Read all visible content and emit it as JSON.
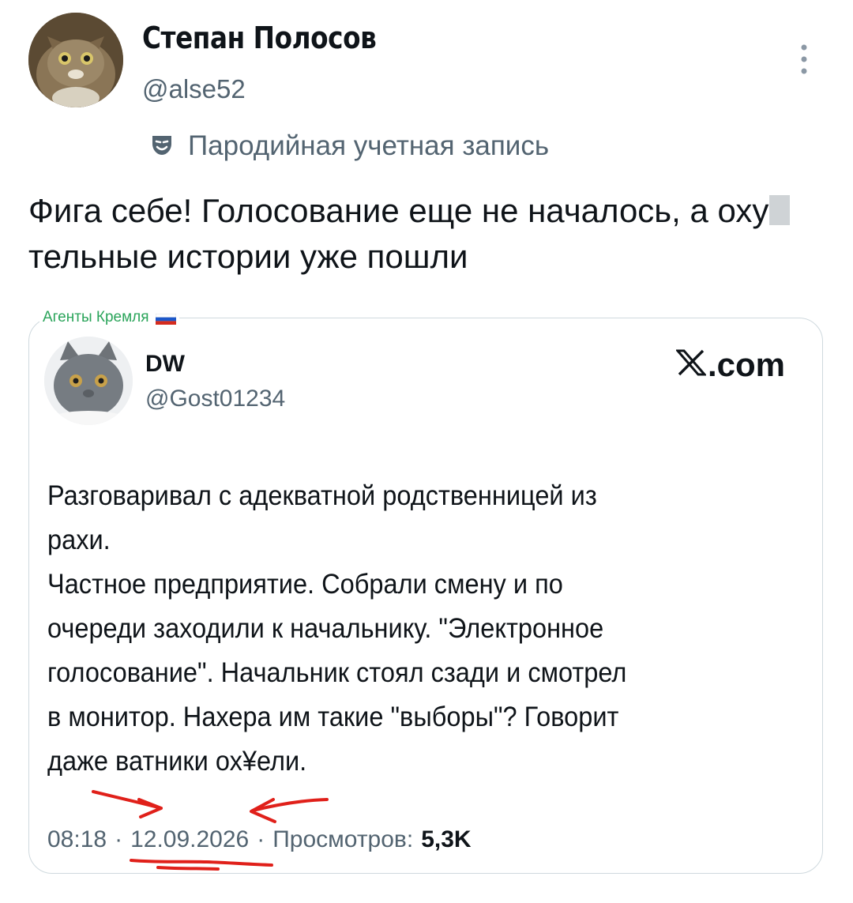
{
  "post": {
    "author_name": "Степан Полосов",
    "handle": "@alse52",
    "parody_label": "Пародийная учетная запись",
    "text_part1": "Фига себе! Голосование еще не началось, а оху",
    "text_part2": "тельные истории уже пошли"
  },
  "quoted": {
    "group_label": "Агенты Кремля",
    "author_name": "DW",
    "handle": "@Gost01234",
    "source": ".com",
    "lines": [
      "Разговаривал с адекватной родственницей из",
      "рахи.",
      "Частное предприятие. Собрали смену и по",
      "очереди заходили к начальнику. \"Электронное",
      "голосование\". Начальник стоял сзади и смотрел",
      "в монитор. Нахера им такие \"выборы\"? Говорит",
      "даже ватники ох¥ели."
    ],
    "time": "08:18",
    "date": "12.09.2026",
    "views_label": "Просмотров:",
    "views_value": "5,3K",
    "separator": "·"
  },
  "icons": {
    "more": "more-vertical-icon",
    "parody": "mask-icon",
    "x_logo": "x-logo-icon",
    "flag": "russian-flag-icon"
  },
  "colors": {
    "text": "#0f1419",
    "secondary": "#536471",
    "green_label": "#2aa45a",
    "annotation_red": "#e0201a"
  }
}
